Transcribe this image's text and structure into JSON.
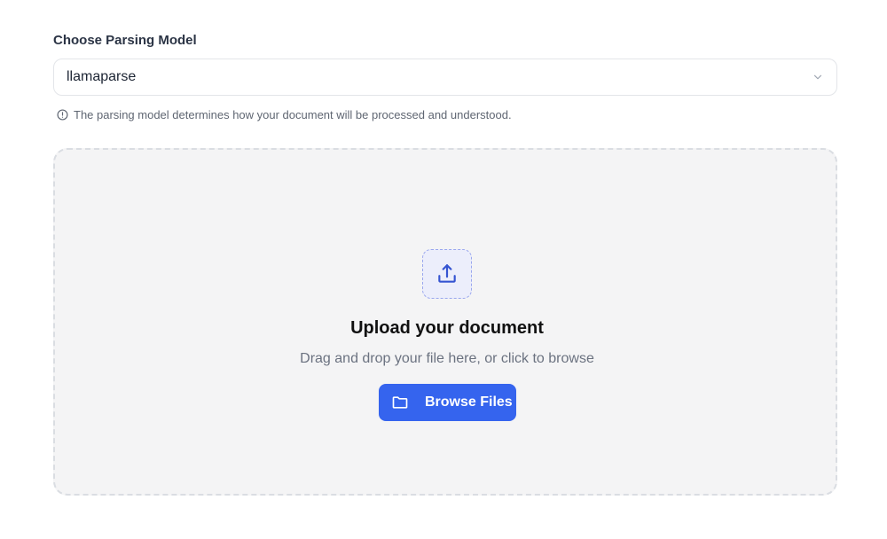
{
  "model_section": {
    "label": "Choose Parsing Model",
    "selected_value": "llamaparse",
    "hint": "The parsing model determines how your document will be processed and understood."
  },
  "upload": {
    "title": "Upload your document",
    "subtitle": "Drag and drop your file here, or click to browse",
    "browse_label": "Browse Files"
  },
  "icons": {
    "select_chevron": "chevron-down-icon",
    "hint": "info-circle-icon",
    "upload": "upload-icon",
    "browse": "folder-icon"
  },
  "colors": {
    "accent": "#3564ee",
    "dropzone_bg": "#f4f4f5"
  }
}
